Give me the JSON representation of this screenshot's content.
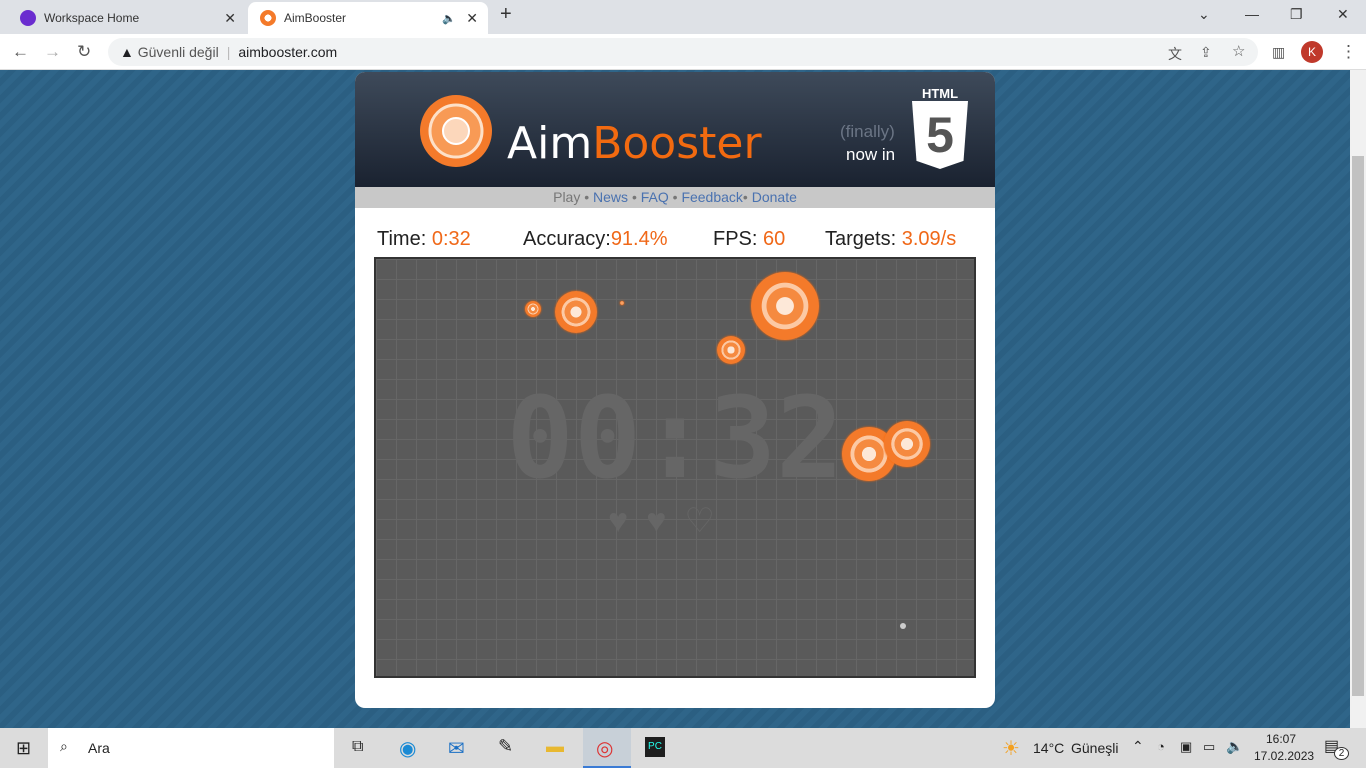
{
  "browser": {
    "tabs": [
      {
        "title": "Workspace Home"
      },
      {
        "title": "AimBooster"
      }
    ],
    "security": "Güvenli değil",
    "url": "aimbooster.com",
    "profile_initial": "K"
  },
  "site": {
    "brand_part1": "Aim",
    "brand_part2": "Booster",
    "finally": "(finally)",
    "now_in": "now in",
    "html5_label": "HTML",
    "html5_digit": "5",
    "menu": [
      {
        "label": "Play"
      },
      {
        "label": "News"
      },
      {
        "label": "FAQ"
      },
      {
        "label": "Feedback"
      },
      {
        "label": "Donate"
      }
    ],
    "separator": "•"
  },
  "stats": {
    "time_label": "Time:",
    "time": "0:32",
    "accuracy_label": "Accuracy:",
    "accuracy": "91.4%",
    "fps_label": "FPS:",
    "fps": "60",
    "targets_label": "Targets:",
    "targets": "3.09/s"
  },
  "game": {
    "clock": "00:32",
    "lives": 2,
    "max_lives": 3,
    "accent": "#f06818"
  },
  "taskbar": {
    "search": "Ara",
    "weather_temp": "14°C",
    "weather_text": "Güneşli",
    "time": "16:07",
    "date": "17.02.2023",
    "notifications": "2"
  }
}
